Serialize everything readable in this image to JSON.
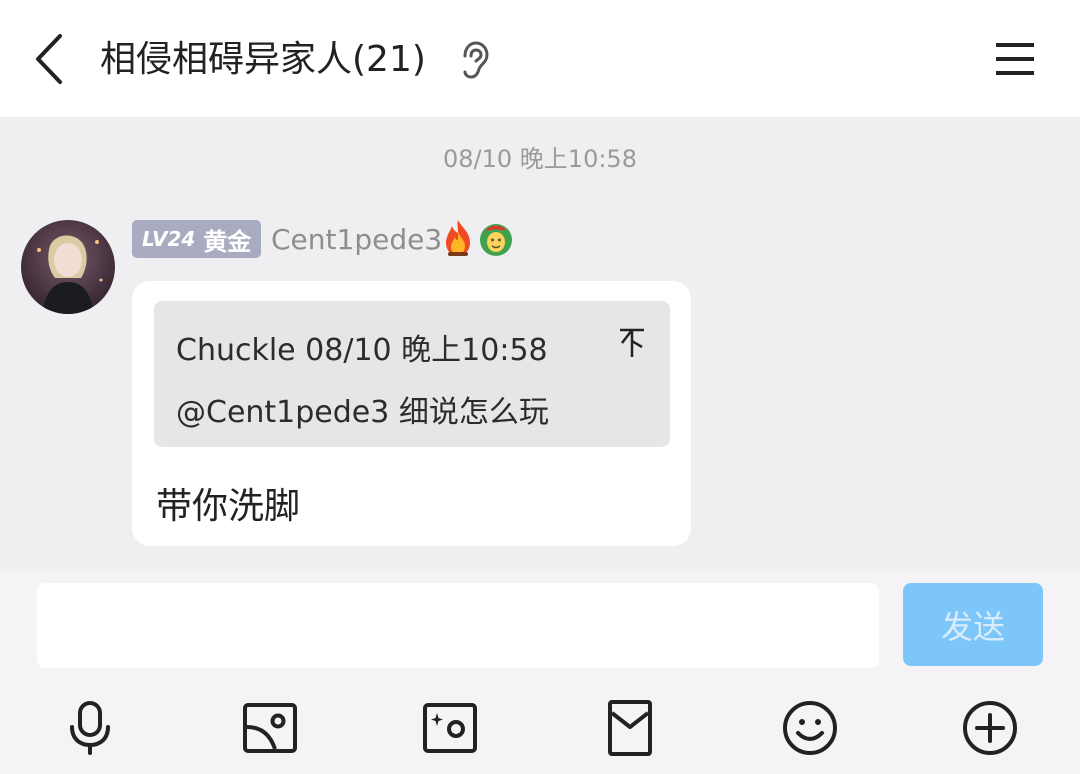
{
  "header": {
    "title": "相侵相碍异家人(21)",
    "icons": {
      "back": "chevron-left-icon",
      "ear": "ear-icon",
      "menu": "menu-icon"
    }
  },
  "chat": {
    "timestamp": "08/10 晚上10:58",
    "message": {
      "level_text": "LV24",
      "rank": "黄金",
      "username": "Cent1pede3",
      "badges": [
        "fire-icon",
        "face-icon"
      ],
      "quote_header": "Chuckle 08/10 晚上10:58",
      "quote_body": "@Cent1pede3 细说怎么玩",
      "text": "带你洗脚"
    }
  },
  "composer": {
    "input_value": "",
    "send_label": "发送",
    "toolbar_icons": [
      "microphone-icon",
      "image-icon",
      "camera-icon",
      "red-packet-icon",
      "emoji-icon",
      "plus-icon"
    ]
  },
  "colors": {
    "chat_background": "#efeff1",
    "send_button": "#7cc6fa",
    "level_badge": "#a9abc1"
  }
}
